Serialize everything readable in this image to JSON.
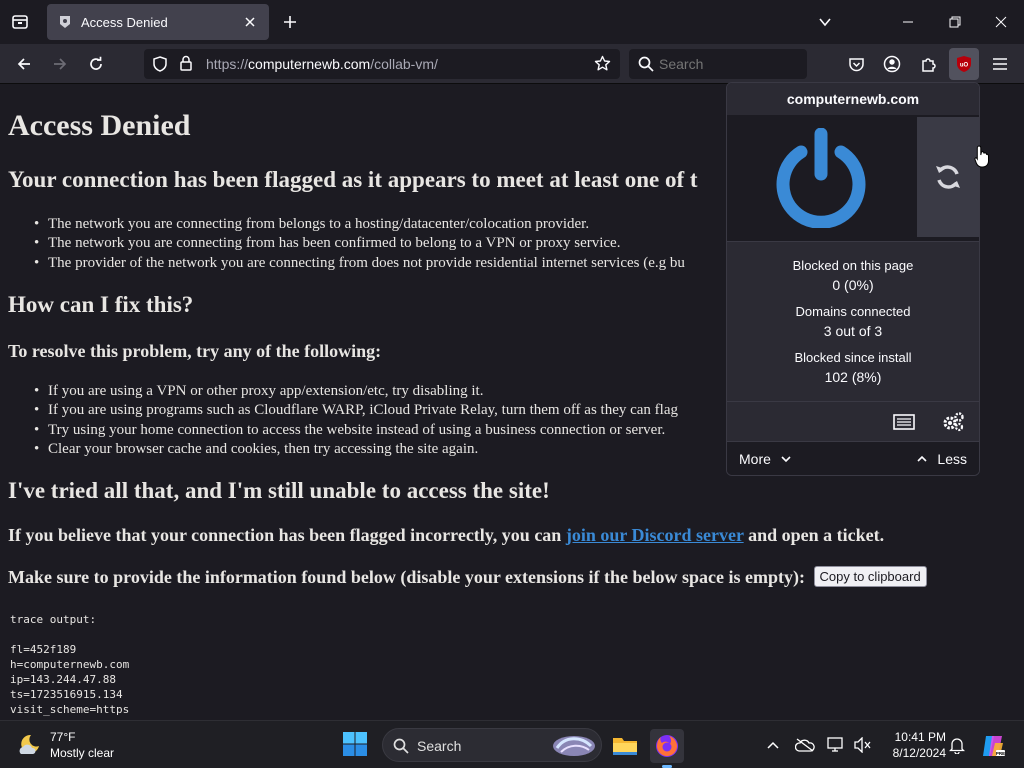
{
  "browser": {
    "tab": {
      "title": "Access Denied"
    },
    "url": {
      "prefix": "https://",
      "host": "computernewb.com",
      "path": "/collab-vm/"
    },
    "search": {
      "placeholder": "Search"
    }
  },
  "page": {
    "title": "Access Denied",
    "heading_flagged": "Your connection has been flagged as it appears to meet at least one of t",
    "reasons": [
      "The network you are connecting from belongs to a hosting/datacenter/colocation provider.",
      "The network you are connecting from has been confirmed to belong to a VPN or proxy service.",
      "The provider of the network you are connecting from does not provide residential internet services (e.g bu"
    ],
    "heading_fix": "How can I fix this?",
    "resolve_intro": "To resolve this problem, try any of the following:",
    "fixes": [
      "If you are using a VPN or other proxy app/extension/etc, try disabling it.",
      "If you are using programs such as Cloudflare WARP, iCloud Private Relay, turn them off as they can flag",
      "Try using your home connection to access the website instead of using a business connection or server.",
      "Clear your browser cache and cookies, then try accessing the site again."
    ],
    "heading_still": "I've tried all that, and I'm still unable to access the site!",
    "believe_prefix": "If you believe that your connection has been flagged incorrectly, you can ",
    "discord_link": "join our Discord server",
    "believe_suffix": " and open a ticket.",
    "provide_info": "Make sure to provide the information found below (disable your extensions if the below space is empty):",
    "copy_button": "Copy to clipboard",
    "trace_label": "trace output:",
    "trace_lines": [
      "fl=452f189",
      "h=computernewb.com",
      "ip=143.244.47.88",
      "ts=1723516915.134",
      "visit_scheme=https"
    ]
  },
  "ublock": {
    "hostname": "computernewb.com",
    "blocked_page_label": "Blocked on this page",
    "blocked_page_value": "0 (0%)",
    "domains_label": "Domains connected",
    "domains_value": "3 out of 3",
    "blocked_install_label": "Blocked since install",
    "blocked_install_value": "102 (8%)",
    "more_label": "More",
    "less_label": "Less",
    "power_color": "#3a8ad6"
  },
  "taskbar": {
    "weather_temp": "77°F",
    "weather_cond": "Mostly clear",
    "search_label": "Search",
    "time": "10:41 PM",
    "date": "8/12/2024"
  }
}
